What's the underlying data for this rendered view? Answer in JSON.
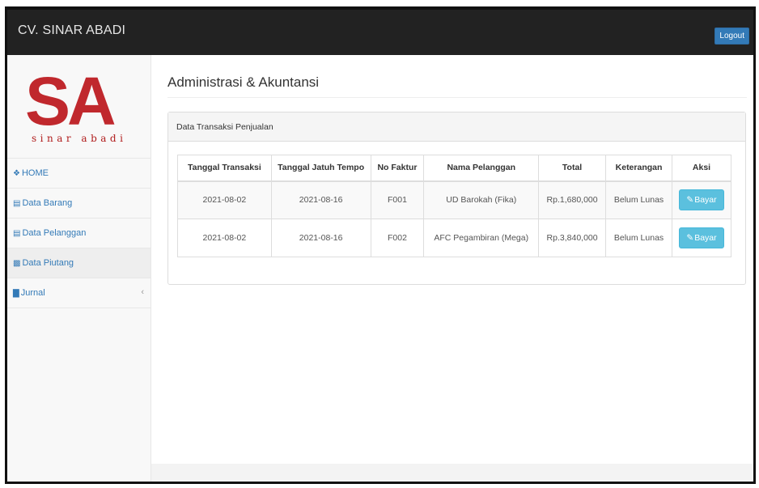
{
  "app": {
    "brand": "CV. SINAR ABADI",
    "logout_label": "Logout"
  },
  "logo": {
    "letters": "SA",
    "subtitle": "sinar abadi"
  },
  "sidebar": {
    "items": [
      {
        "icon": "home-icon",
        "label": "HOME"
      },
      {
        "icon": "file-icon",
        "label": "Data Barang"
      },
      {
        "icon": "file-icon",
        "label": "Data Pelanggan"
      },
      {
        "icon": "book-icon",
        "label": "Data Piutang",
        "active": true
      },
      {
        "icon": "chart-icon",
        "label": "Jurnal",
        "chevron": "‹"
      }
    ]
  },
  "main": {
    "title": "Administrasi & Akuntansi",
    "panel_heading": "Data Transaksi Penjualan",
    "table": {
      "headers": [
        "Tanggal Transaksi",
        "Tanggal Jatuh Tempo",
        "No Faktur",
        "Nama Pelanggan",
        "Total",
        "Keterangan",
        "Aksi"
      ],
      "rows": [
        {
          "tanggal_transaksi": "2021-08-02",
          "tanggal_jatuh_tempo": "2021-08-16",
          "no_faktur": "F001",
          "nama_pelanggan": "UD Barokah (Fika)",
          "total": "Rp.1,680,000",
          "keterangan": "Belum Lunas",
          "aksi": "Bayar"
        },
        {
          "tanggal_transaksi": "2021-08-02",
          "tanggal_jatuh_tempo": "2021-08-16",
          "no_faktur": "F002",
          "nama_pelanggan": "AFC Pegambiran (Mega)",
          "total": "Rp.3,840,000",
          "keterangan": "Belum Lunas",
          "aksi": "Bayar"
        }
      ]
    }
  },
  "colors": {
    "navbar": "#222222",
    "logo_red": "#c0282d",
    "link": "#337ab7",
    "info_button": "#5bc0de",
    "logout_button": "#337ab7"
  }
}
